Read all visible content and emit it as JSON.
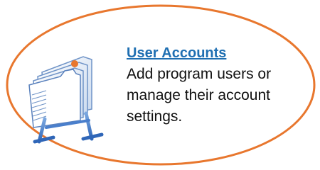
{
  "tile": {
    "title": "User Accounts",
    "description": "Add program users or manage their account settings.",
    "icon": "rolodex-card-file-icon",
    "highlight_color": "#e8772e",
    "link_color": "#1f6fb2"
  }
}
